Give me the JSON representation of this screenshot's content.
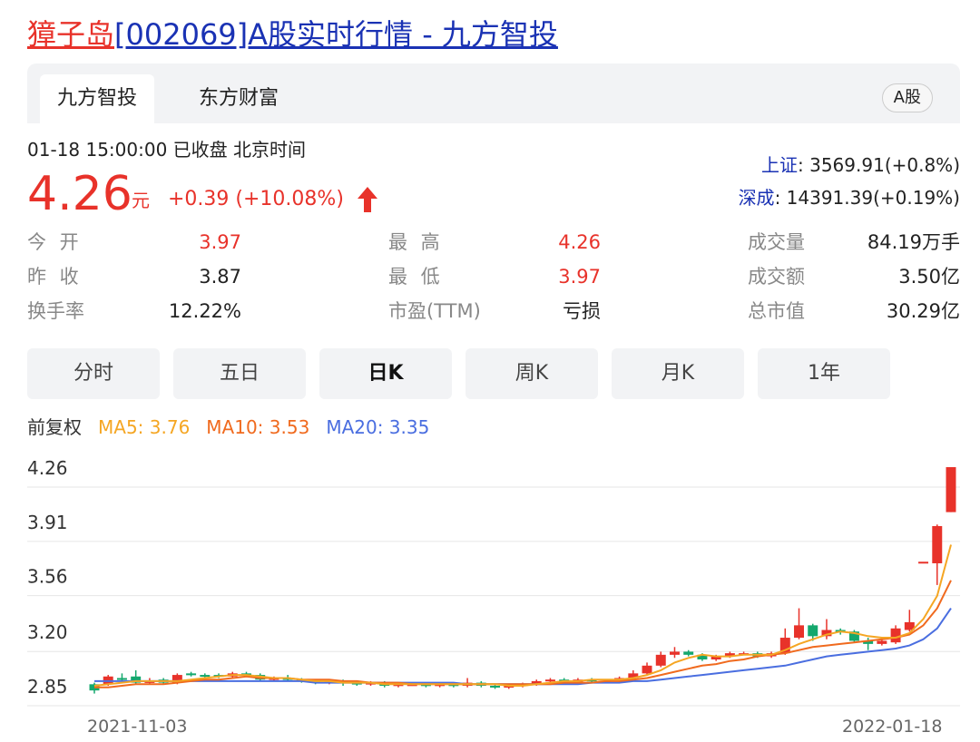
{
  "title": {
    "stock_name": "獐子岛",
    "rest": "[002069]A股实时行情 - 九方智投"
  },
  "tabs": [
    {
      "label": "九方智投",
      "active": true
    },
    {
      "label": "东方财富",
      "active": false
    }
  ],
  "market_badge": "A股",
  "status_line": "01-18 15:00:00  已收盘  北京时间",
  "quote": {
    "price": "4.26",
    "unit": "元",
    "change": "+0.39 (+10.08%)",
    "direction": "up"
  },
  "indices": [
    {
      "name": "上证",
      "value": ": 3569.91(+0.8%)"
    },
    {
      "name": "深成",
      "value": ": 14391.39(+0.19%)"
    }
  ],
  "stats": {
    "open_label": "今 开",
    "open": "3.97",
    "prev_close_label": "昨 收",
    "prev_close": "3.87",
    "turnover_label": "换手率",
    "turnover": "12.22%",
    "high_label": "最 高",
    "high": "4.26",
    "low_label": "最 低",
    "low": "3.97",
    "pe_label": "市盈(TTM)",
    "pe": "亏损",
    "volume_label": "成交量",
    "volume": "84.19万手",
    "amount_label": "成交额",
    "amount": "3.50亿",
    "mktcap_label": "总市值",
    "mktcap": "30.29亿"
  },
  "period_tabs": [
    "分时",
    "五日",
    "日K",
    "周K",
    "月K",
    "1年"
  ],
  "active_period": "日K",
  "ma_legend": {
    "adjust": "前复权",
    "ma5": "MA5: 3.76",
    "ma10": "MA10: 3.53",
    "ma20": "MA20: 3.35"
  },
  "colors": {
    "up": "#e8322a",
    "down": "#14a86d",
    "ma5": "#f5a623",
    "ma10": "#f06a1e",
    "ma20": "#4a6ee0",
    "link": "#1a32b4"
  },
  "chart_data": {
    "type": "candlestick",
    "y_ticks": [
      "4.26",
      "3.91",
      "3.56",
      "3.20",
      "2.85"
    ],
    "ylim": [
      2.78,
      4.26
    ],
    "x_start_label": "2021-11-03",
    "x_end_label": "2022-01-18",
    "candles": [
      [
        2.86,
        2.82,
        2.87,
        2.8
      ],
      [
        2.86,
        2.91,
        2.92,
        2.85
      ],
      [
        2.9,
        2.89,
        2.93,
        2.87
      ],
      [
        2.91,
        2.87,
        2.95,
        2.86
      ],
      [
        2.87,
        2.88,
        2.9,
        2.86
      ],
      [
        2.89,
        2.87,
        2.9,
        2.86
      ],
      [
        2.87,
        2.92,
        2.93,
        2.86
      ],
      [
        2.93,
        2.92,
        2.94,
        2.91
      ],
      [
        2.92,
        2.91,
        2.93,
        2.9
      ],
      [
        2.92,
        2.91,
        2.93,
        2.9
      ],
      [
        2.91,
        2.93,
        2.94,
        2.9
      ],
      [
        2.93,
        2.92,
        2.94,
        2.91
      ],
      [
        2.92,
        2.89,
        2.93,
        2.88
      ],
      [
        2.89,
        2.9,
        2.91,
        2.88
      ],
      [
        2.9,
        2.89,
        2.92,
        2.88
      ],
      [
        2.89,
        2.88,
        2.9,
        2.87
      ],
      [
        2.88,
        2.87,
        2.89,
        2.86
      ],
      [
        2.87,
        2.88,
        2.89,
        2.86
      ],
      [
        2.88,
        2.87,
        2.89,
        2.85
      ],
      [
        2.87,
        2.86,
        2.88,
        2.85
      ],
      [
        2.86,
        2.87,
        2.88,
        2.85
      ],
      [
        2.87,
        2.85,
        2.88,
        2.84
      ],
      [
        2.85,
        2.86,
        2.87,
        2.84
      ],
      [
        2.86,
        2.86,
        2.87,
        2.85
      ],
      [
        2.86,
        2.85,
        2.87,
        2.84
      ],
      [
        2.85,
        2.86,
        2.87,
        2.84
      ],
      [
        2.86,
        2.85,
        2.87,
        2.84
      ],
      [
        2.85,
        2.87,
        2.9,
        2.84
      ],
      [
        2.87,
        2.85,
        2.88,
        2.84
      ],
      [
        2.85,
        2.84,
        2.86,
        2.83
      ],
      [
        2.84,
        2.85,
        2.86,
        2.83
      ],
      [
        2.85,
        2.86,
        2.87,
        2.84
      ],
      [
        2.86,
        2.88,
        2.89,
        2.85
      ],
      [
        2.88,
        2.89,
        2.9,
        2.87
      ],
      [
        2.89,
        2.87,
        2.9,
        2.86
      ],
      [
        2.87,
        2.89,
        2.9,
        2.86
      ],
      [
        2.89,
        2.88,
        2.9,
        2.87
      ],
      [
        2.88,
        2.88,
        2.89,
        2.87
      ],
      [
        2.88,
        2.9,
        2.91,
        2.87
      ],
      [
        2.9,
        2.93,
        2.95,
        2.89
      ],
      [
        2.93,
        2.98,
        3.0,
        2.92
      ],
      [
        2.98,
        3.05,
        3.07,
        2.97
      ],
      [
        3.05,
        3.07,
        3.1,
        3.03
      ],
      [
        3.07,
        3.05,
        3.08,
        3.04
      ],
      [
        3.05,
        3.02,
        3.06,
        3.01
      ],
      [
        3.02,
        3.04,
        3.05,
        3.01
      ],
      [
        3.04,
        3.06,
        3.07,
        3.03
      ],
      [
        3.06,
        3.06,
        3.07,
        3.05
      ],
      [
        3.06,
        3.04,
        3.07,
        3.03
      ],
      [
        3.04,
        3.06,
        3.07,
        3.03
      ],
      [
        3.06,
        3.16,
        3.22,
        3.05
      ],
      [
        3.16,
        3.24,
        3.35,
        3.15
      ],
      [
        3.24,
        3.17,
        3.25,
        3.14
      ],
      [
        3.17,
        3.21,
        3.28,
        3.15
      ],
      [
        3.21,
        3.2,
        3.22,
        3.18
      ],
      [
        3.2,
        3.14,
        3.21,
        3.13
      ],
      [
        3.14,
        3.12,
        3.16,
        3.08
      ],
      [
        3.12,
        3.14,
        3.16,
        3.11
      ],
      [
        3.13,
        3.22,
        3.24,
        3.12
      ],
      [
        3.21,
        3.26,
        3.34,
        3.2
      ],
      [
        3.65,
        3.65,
        3.65,
        3.65
      ],
      [
        3.64,
        3.88,
        3.89,
        3.5
      ],
      [
        3.97,
        4.26,
        4.26,
        3.97
      ]
    ],
    "ma5": [
      2.85,
      2.86,
      2.87,
      2.88,
      2.88,
      2.88,
      2.88,
      2.89,
      2.9,
      2.91,
      2.92,
      2.92,
      2.91,
      2.9,
      2.9,
      2.89,
      2.88,
      2.88,
      2.87,
      2.87,
      2.87,
      2.86,
      2.86,
      2.86,
      2.86,
      2.86,
      2.86,
      2.86,
      2.86,
      2.86,
      2.85,
      2.85,
      2.86,
      2.87,
      2.88,
      2.88,
      2.89,
      2.89,
      2.89,
      2.9,
      2.92,
      2.95,
      3.0,
      3.03,
      3.05,
      3.04,
      3.04,
      3.05,
      3.05,
      3.05,
      3.08,
      3.12,
      3.15,
      3.18,
      3.2,
      3.19,
      3.17,
      3.16,
      3.16,
      3.19,
      3.28,
      3.43,
      3.76
    ],
    "ma10": [
      2.84,
      2.84,
      2.85,
      2.86,
      2.86,
      2.86,
      2.87,
      2.88,
      2.89,
      2.89,
      2.9,
      2.91,
      2.9,
      2.9,
      2.9,
      2.89,
      2.89,
      2.89,
      2.88,
      2.88,
      2.87,
      2.87,
      2.87,
      2.86,
      2.86,
      2.86,
      2.86,
      2.86,
      2.86,
      2.86,
      2.86,
      2.86,
      2.86,
      2.86,
      2.87,
      2.87,
      2.87,
      2.88,
      2.88,
      2.89,
      2.9,
      2.92,
      2.94,
      2.96,
      2.98,
      2.99,
      3.01,
      3.02,
      3.04,
      3.05,
      3.06,
      3.08,
      3.1,
      3.11,
      3.12,
      3.13,
      3.14,
      3.15,
      3.16,
      3.18,
      3.24,
      3.35,
      3.53
    ],
    "ma20": [
      2.88,
      2.88,
      2.88,
      2.88,
      2.88,
      2.88,
      2.88,
      2.88,
      2.88,
      2.88,
      2.88,
      2.88,
      2.88,
      2.88,
      2.88,
      2.88,
      2.87,
      2.87,
      2.87,
      2.87,
      2.87,
      2.87,
      2.87,
      2.87,
      2.87,
      2.87,
      2.87,
      2.86,
      2.86,
      2.86,
      2.86,
      2.86,
      2.86,
      2.86,
      2.86,
      2.86,
      2.87,
      2.87,
      2.87,
      2.88,
      2.88,
      2.89,
      2.9,
      2.91,
      2.92,
      2.93,
      2.94,
      2.95,
      2.96,
      2.97,
      2.98,
      3.0,
      3.02,
      3.04,
      3.05,
      3.06,
      3.07,
      3.08,
      3.09,
      3.11,
      3.15,
      3.22,
      3.35
    ]
  }
}
